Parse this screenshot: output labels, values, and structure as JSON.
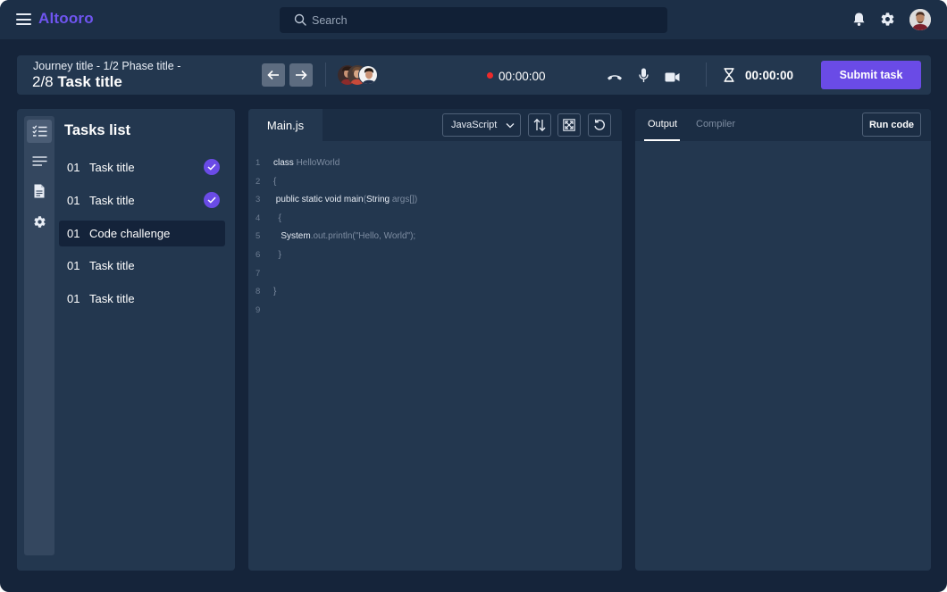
{
  "app": {
    "name": "Altooro"
  },
  "search": {
    "placeholder": "Search"
  },
  "header": {
    "breadcrumb": "Journey title - 1/2 Phase title -",
    "task_position": "2/8",
    "task_title": "Task title",
    "recording_time": "00:00:00",
    "task_timer": "00:00:00",
    "submit_label": "Submit task"
  },
  "tasks": {
    "title": "Tasks list",
    "items": [
      {
        "number": "01",
        "label": "Task title",
        "completed": true
      },
      {
        "number": "01",
        "label": "Task title",
        "completed": true
      },
      {
        "number": "01",
        "label": "Code challenge",
        "completed": false,
        "active": true
      },
      {
        "number": "01",
        "label": "Task title",
        "completed": false
      },
      {
        "number": "01",
        "label": "Task title",
        "completed": false
      }
    ]
  },
  "editor": {
    "file_tab": "Main.js",
    "language": "JavaScript",
    "lines": [
      {
        "n": "1",
        "code": "class ",
        "dim": "HelloWorld",
        "rest": ""
      },
      {
        "n": "2",
        "code": "",
        "dim": "{",
        "rest": ""
      },
      {
        "n": "3",
        "code": " public static void main",
        "dim": "(",
        "rest": "String ",
        "dim2": "args[])"
      },
      {
        "n": "4",
        "code": "",
        "dim": "  {",
        "rest": ""
      },
      {
        "n": "5",
        "code": "   System",
        "dim": ".out.println(\"Hello, World\");",
        "rest": ""
      },
      {
        "n": "6",
        "code": "",
        "dim": "  }",
        "rest": ""
      },
      {
        "n": "7",
        "code": "",
        "dim": "",
        "rest": ""
      },
      {
        "n": "8",
        "code": "",
        "dim": "}",
        "rest": ""
      },
      {
        "n": "9",
        "code": "",
        "dim": "",
        "rest": ""
      }
    ]
  },
  "output": {
    "tabs": [
      "Output",
      "Compiler"
    ],
    "run_label": "Run code"
  },
  "colors": {
    "accent": "#6a4be6",
    "background": "#15243a",
    "panel": "#23374f",
    "recording": "#ee2a2a"
  },
  "icons": [
    "menu-icon",
    "search-icon",
    "bell-icon",
    "gear-icon",
    "arrow-left-icon",
    "arrow-right-icon",
    "phone-icon",
    "mic-icon",
    "camera-icon",
    "hourglass-icon",
    "checklist-icon",
    "lines-icon",
    "document-icon",
    "swap-icon",
    "fullscreen-icon",
    "reset-icon",
    "chevron-down-icon",
    "check-icon"
  ]
}
